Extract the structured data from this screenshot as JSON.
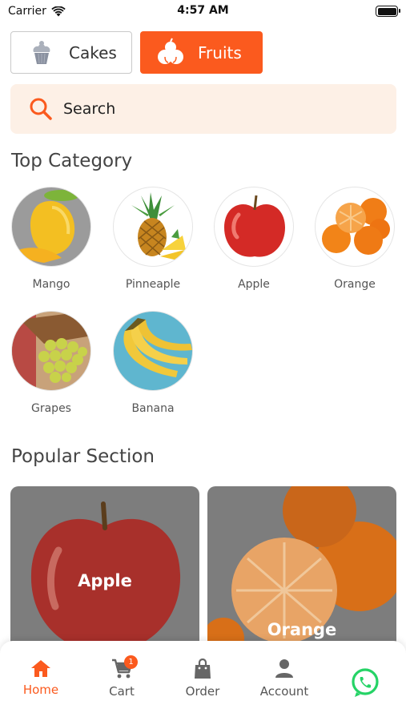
{
  "status": {
    "carrier": "Carrier",
    "time": "4:57 AM"
  },
  "tabs": [
    {
      "label": "Cakes",
      "icon": "cupcake-icon",
      "active": false
    },
    {
      "label": "Fruits",
      "icon": "fruits-icon",
      "active": true
    }
  ],
  "search": {
    "placeholder": "Search",
    "value": ""
  },
  "top_category": {
    "title": "Top Category",
    "items": [
      {
        "label": "Mango",
        "image": "mango-image"
      },
      {
        "label": "Pinneaple",
        "image": "pineapple-image"
      },
      {
        "label": "Apple",
        "image": "apple-image"
      },
      {
        "label": "Orange",
        "image": "orange-image"
      },
      {
        "label": "Grapes",
        "image": "grapes-image"
      },
      {
        "label": "Banana",
        "image": "banana-image"
      }
    ]
  },
  "popular": {
    "title": "Popular Section",
    "items": [
      {
        "label": "Apple",
        "image": "apple-image"
      },
      {
        "label": "Orange",
        "image": "orange-image"
      }
    ]
  },
  "nav": {
    "items": [
      {
        "label": "Home",
        "icon": "home-icon",
        "active": true
      },
      {
        "label": "Cart",
        "icon": "cart-icon",
        "badge": "1"
      },
      {
        "label": "Order",
        "icon": "shopping-bag-icon"
      },
      {
        "label": "Account",
        "icon": "person-icon"
      }
    ],
    "whatsapp_icon": "whatsapp-icon"
  },
  "colors": {
    "accent": "#fb5a1e",
    "search_bg": "#fdf0e6",
    "whatsapp": "#25d366"
  }
}
